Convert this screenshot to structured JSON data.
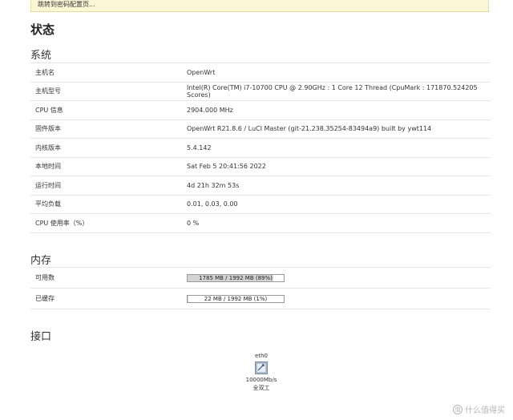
{
  "notice": {
    "text": "跳转到密码配置页..."
  },
  "page": {
    "title": "状态"
  },
  "system": {
    "heading": "系统",
    "rows": [
      {
        "key": "主机名",
        "value": "OpenWrt"
      },
      {
        "key": "主机型号",
        "value": "Intel(R) Core(TM) i7-10700 CPU @ 2.90GHz : 1 Core 12 Thread (CpuMark : 171870.524205 Scores)"
      },
      {
        "key": "CPU 信息",
        "value": "2904.000 MHz"
      },
      {
        "key": "固件版本",
        "value": "OpenWrt R21.8.6 / LuCI Master (git-21.238.35254-83494a9) built by ywt114"
      },
      {
        "key": "内核版本",
        "value": "5.4.142"
      },
      {
        "key": "本地时间",
        "value": "Sat Feb 5 20:41:56 2022"
      },
      {
        "key": "运行时间",
        "value": "4d 21h 32m 53s"
      },
      {
        "key": "平均负载",
        "value": "0.01, 0.03, 0.00"
      },
      {
        "key": "CPU 使用率（%）",
        "value": "0 %"
      }
    ]
  },
  "memory": {
    "heading": "内存",
    "rows": [
      {
        "key": "可用数",
        "bar_label": "1785 MB / 1992 MB (89%)",
        "percent": 89
      },
      {
        "key": "已缓存",
        "bar_label": "22 MB / 1992 MB (1%)",
        "percent": 1
      }
    ]
  },
  "interfaces": {
    "heading": "接口",
    "items": [
      {
        "name": "eth0",
        "icon": "ethernet-port-icon",
        "speed": "10000Mb/s",
        "duplex": "全双工"
      }
    ]
  },
  "watermark": {
    "text": "什么值得买",
    "icon": "smzdm-logo-icon"
  }
}
